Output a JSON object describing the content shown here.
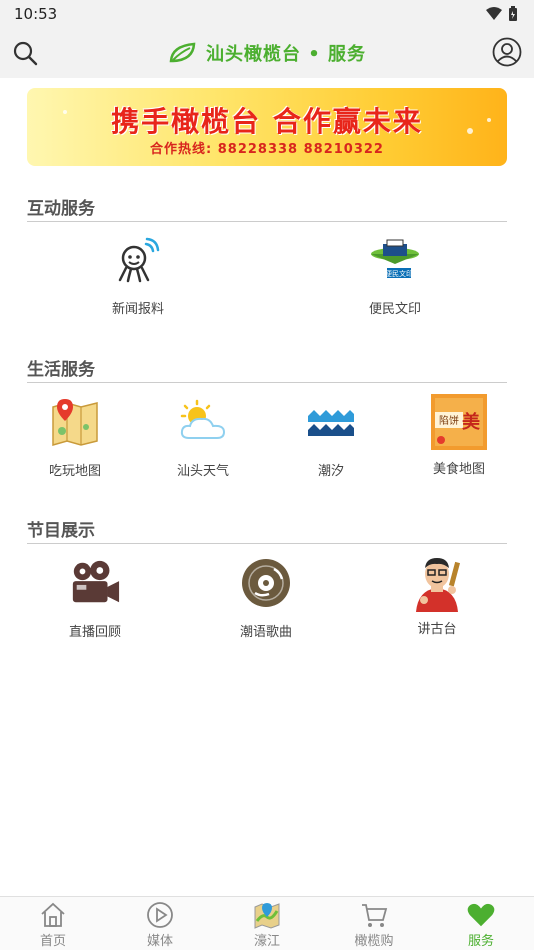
{
  "status_bar": {
    "time": "10:53"
  },
  "app_bar": {
    "title": "汕头橄榄台 • 服务"
  },
  "banner": {
    "headline": "携手橄榄台 合作赢未来",
    "hotline": "合作热线: 88228338 88210322"
  },
  "sections": [
    {
      "title": "互动服务",
      "items": [
        {
          "label": "新闻报料",
          "icon": "reporter-icon"
        },
        {
          "label": "便民文印",
          "icon": "print-icon"
        }
      ]
    },
    {
      "title": "生活服务",
      "items": [
        {
          "label": "吃玩地图",
          "icon": "map-pin-icon"
        },
        {
          "label": "汕头天气",
          "icon": "weather-icon"
        },
        {
          "label": "潮汐",
          "icon": "tide-icon"
        },
        {
          "label": "美食地图",
          "icon": "food-map-icon"
        }
      ]
    },
    {
      "title": "节目展示",
      "items": [
        {
          "label": "直播回顾",
          "icon": "camera-icon"
        },
        {
          "label": "潮语歌曲",
          "icon": "disc-icon"
        },
        {
          "label": "讲古台",
          "icon": "storyteller-icon"
        }
      ]
    }
  ],
  "tabs": [
    {
      "label": "首页",
      "icon": "home-icon"
    },
    {
      "label": "媒体",
      "icon": "play-icon"
    },
    {
      "label": "濠江",
      "icon": "map-icon"
    },
    {
      "label": "橄榄购",
      "icon": "cart-icon"
    },
    {
      "label": "服务",
      "icon": "heart-icon",
      "active": true
    }
  ],
  "colors": {
    "accent": "#4caf30",
    "banner_red": "#e8251a"
  }
}
